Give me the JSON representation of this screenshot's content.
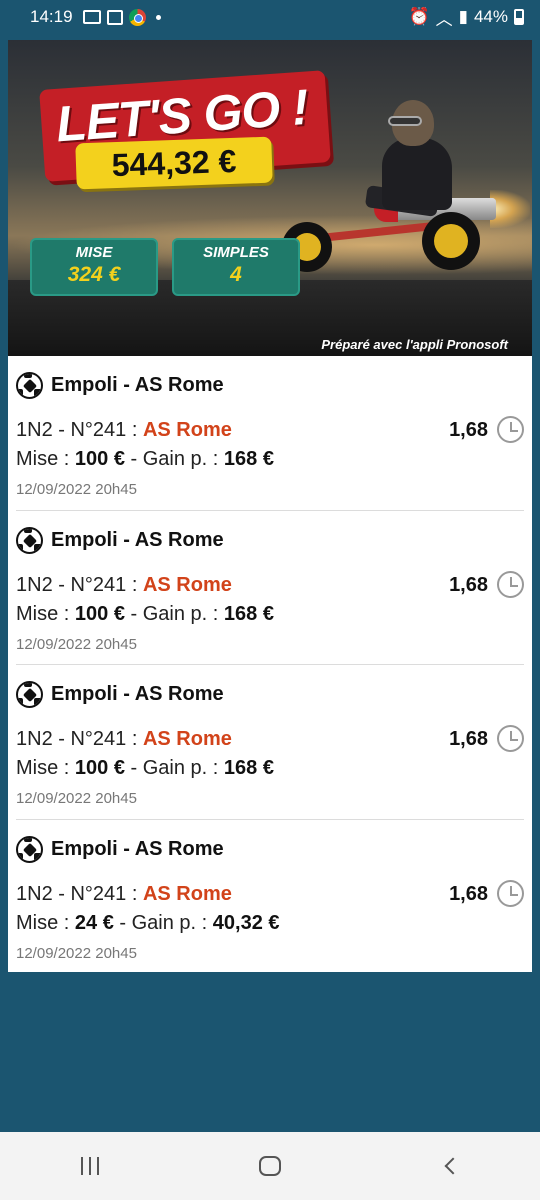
{
  "status_bar": {
    "time": "14:19",
    "battery_percent": "44%",
    "icons_left": [
      "screen-icon",
      "image-icon",
      "chrome-icon",
      "dot"
    ],
    "icons_right": [
      "alarm-icon",
      "wifi-icon",
      "signal-icon",
      "battery-icon"
    ]
  },
  "banner": {
    "title": "LET'S GO !",
    "total_amount": "544,32 €",
    "stake_label": "MISE",
    "stake_value": "324 €",
    "bets_label": "SIMPLES",
    "bets_value": "4",
    "credit": "Préparé avec l'appli Pronosoft"
  },
  "bets": [
    {
      "match": "Empoli - AS Rome",
      "market": "1N2 - N°241 : ",
      "pick": "AS Rome",
      "odds": "1,68",
      "stake_prefix": "Mise : ",
      "stake": "100 €",
      "gain_prefix": " - Gain p. : ",
      "gain": "168 €",
      "date": "12/09/2022 20h45"
    },
    {
      "match": "Empoli - AS Rome",
      "market": "1N2 - N°241 : ",
      "pick": "AS Rome",
      "odds": "1,68",
      "stake_prefix": "Mise : ",
      "stake": "100 €",
      "gain_prefix": " - Gain p. : ",
      "gain": "168 €",
      "date": "12/09/2022 20h45"
    },
    {
      "match": "Empoli - AS Rome",
      "market": "1N2 - N°241 : ",
      "pick": "AS Rome",
      "odds": "1,68",
      "stake_prefix": "Mise : ",
      "stake": "100 €",
      "gain_prefix": " - Gain p. : ",
      "gain": "168 €",
      "date": "12/09/2022 20h45"
    },
    {
      "match": "Empoli - AS Rome",
      "market": "1N2 - N°241 : ",
      "pick": "AS Rome",
      "odds": "1,68",
      "stake_prefix": "Mise : ",
      "stake": "24 €",
      "gain_prefix": " - Gain p. : ",
      "gain": "40,32 €",
      "date": "12/09/2022 20h45"
    }
  ],
  "colors": {
    "background": "#1b5570",
    "pick": "#d2431a",
    "title_plate": "#c41f26",
    "amount_plate": "#f3d11d",
    "stat_plate": "#1f7a6a"
  },
  "navbar": {
    "icons": [
      "recents-icon",
      "home-icon",
      "back-icon"
    ]
  }
}
